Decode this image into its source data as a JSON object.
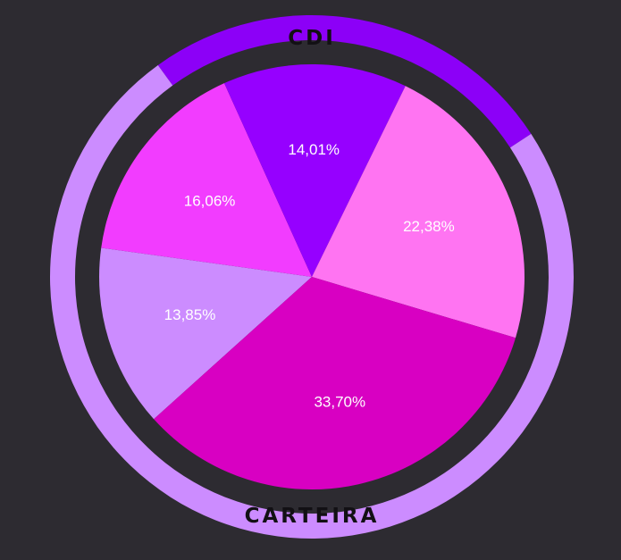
{
  "chart_data": {
    "type": "pie",
    "slices": [
      {
        "value": 13.85,
        "label": "13,85%",
        "color": "#cc8cff",
        "text_color": "#1e1b22"
      },
      {
        "value": 16.06,
        "label": "16,06%",
        "color": "#f23cff",
        "text_color": "#ffffff"
      },
      {
        "value": 14.01,
        "label": "14,01%",
        "color": "#9600ff",
        "text_color": "#ffffff"
      },
      {
        "value": 22.38,
        "label": "22,38%",
        "color": "#ff74f2",
        "text_color": "#1e1b22"
      },
      {
        "value": 33.7,
        "label": "33,70%",
        "color": "#d800c2",
        "text_color": "#ffffff"
      }
    ],
    "outer_ring": {
      "segments": [
        {
          "name": "CDI",
          "value": 25.8,
          "color": "#8c00f7"
        },
        {
          "name": "CARTEIRA",
          "value": 74.2,
          "color": "#cc8cff"
        }
      ]
    },
    "background_color": "#2d2b31"
  }
}
